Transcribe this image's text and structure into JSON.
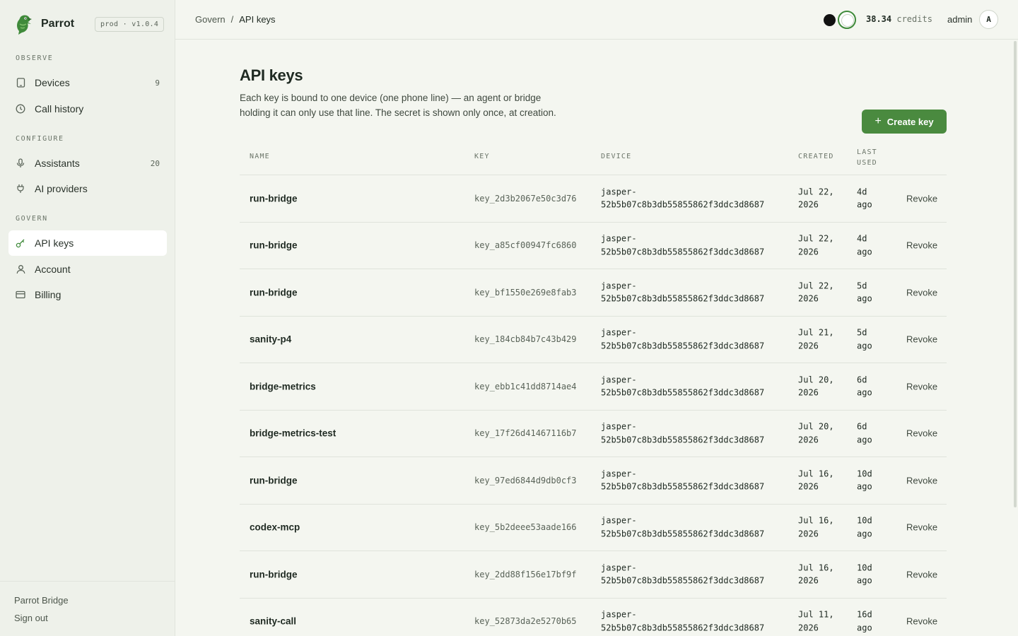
{
  "sidebar": {
    "brand": "Parrot",
    "env_badge": "prod · v1.0.4",
    "sections": [
      {
        "title": "OBSERVE"
      },
      {
        "title": "CONFIGURE"
      },
      {
        "title": "GOVERN"
      }
    ],
    "items": {
      "devices": {
        "label": "Devices",
        "count": "9",
        "icon": "tablet-icon"
      },
      "call_history": {
        "label": "Call history",
        "icon": "clock-icon"
      },
      "assistants": {
        "label": "Assistants",
        "count": "20",
        "icon": "microphone-icon"
      },
      "ai_providers": {
        "label": "AI providers",
        "icon": "plug-icon"
      },
      "api_keys": {
        "label": "API keys",
        "icon": "key-icon",
        "active": true
      },
      "account": {
        "label": "Account",
        "icon": "user-icon"
      },
      "billing": {
        "label": "Billing",
        "icon": "credit-card-icon"
      }
    },
    "footer": {
      "bridge": "Parrot Bridge",
      "sign_out": "Sign out"
    }
  },
  "topbar": {
    "breadcrumb": [
      "Govern",
      "/",
      "API keys"
    ],
    "credits_value": "38.34",
    "credits_label": "credits",
    "user": "admin",
    "avatar": "A"
  },
  "main": {
    "title": "API keys",
    "description": "Each key is bound to one device (one phone line) — an agent or bridge holding it can only use that line. The secret is shown only once, at creation.",
    "create_button": "Create key",
    "columns": {
      "name": "NAME",
      "key": "KEY",
      "device": "DEVICE",
      "created": "CREATED",
      "last_used": "LAST USED"
    },
    "rows": [
      {
        "name": "run-bridge",
        "key": "key_2d3b2067e50c3d76",
        "device": "jasper-52b5b07c8b3db55855862f3ddc3d8687",
        "created": "Jul 22, 2026",
        "last_used": "4d ago",
        "action": "Revoke"
      },
      {
        "name": "run-bridge",
        "key": "key_a85cf00947fc6860",
        "device": "jasper-52b5b07c8b3db55855862f3ddc3d8687",
        "created": "Jul 22, 2026",
        "last_used": "4d ago",
        "action": "Revoke"
      },
      {
        "name": "run-bridge",
        "key": "key_bf1550e269e8fab3",
        "device": "jasper-52b5b07c8b3db55855862f3ddc3d8687",
        "created": "Jul 22, 2026",
        "last_used": "5d ago",
        "action": "Revoke"
      },
      {
        "name": "sanity-p4",
        "key": "key_184cb84b7c43b429",
        "device": "jasper-52b5b07c8b3db55855862f3ddc3d8687",
        "created": "Jul 21, 2026",
        "last_used": "5d ago",
        "action": "Revoke"
      },
      {
        "name": "bridge-metrics",
        "key": "key_ebb1c41dd8714ae4",
        "device": "jasper-52b5b07c8b3db55855862f3ddc3d8687",
        "created": "Jul 20, 2026",
        "last_used": "6d ago",
        "action": "Revoke"
      },
      {
        "name": "bridge-metrics-test",
        "key": "key_17f26d41467116b7",
        "device": "jasper-52b5b07c8b3db55855862f3ddc3d8687",
        "created": "Jul 20, 2026",
        "last_used": "6d ago",
        "action": "Revoke"
      },
      {
        "name": "run-bridge",
        "key": "key_97ed6844d9db0cf3",
        "device": "jasper-52b5b07c8b3db55855862f3ddc3d8687",
        "created": "Jul 16, 2026",
        "last_used": "10d ago",
        "action": "Revoke"
      },
      {
        "name": "codex-mcp",
        "key": "key_5b2deee53aade166",
        "device": "jasper-52b5b07c8b3db55855862f3ddc3d8687",
        "created": "Jul 16, 2026",
        "last_used": "10d ago",
        "action": "Revoke"
      },
      {
        "name": "run-bridge",
        "key": "key_2dd88f156e17bf9f",
        "device": "jasper-52b5b07c8b3db55855862f3ddc3d8687",
        "created": "Jul 16, 2026",
        "last_used": "10d ago",
        "action": "Revoke"
      },
      {
        "name": "sanity-call",
        "key": "key_52873da2e5270b65",
        "device": "jasper-52b5b07c8b3db55855862f3ddc3d8687",
        "created": "Jul 11, 2026",
        "last_used": "16d ago",
        "action": "Revoke"
      }
    ]
  },
  "colors": {
    "accent": "#4a8a3f",
    "background": "#f4f6f0",
    "sidebar": "#eef1ea"
  }
}
